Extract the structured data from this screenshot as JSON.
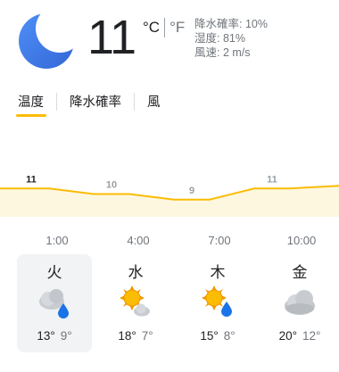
{
  "current": {
    "temperature": "11",
    "unit_c": "°C",
    "unit_f": "°F",
    "precipitation": "降水確率: 10%",
    "humidity": "湿度: 81%",
    "wind": "風速: 2 m/s",
    "icon": "moon-icon"
  },
  "tabs": [
    {
      "label": "温度",
      "active": true
    },
    {
      "label": "降水確率",
      "active": false
    },
    {
      "label": "風",
      "active": false
    }
  ],
  "chart_data": {
    "type": "area",
    "x": [
      "1:00",
      "4:00",
      "7:00",
      "10:00"
    ],
    "values": [
      11,
      10,
      9,
      11
    ],
    "labels": [
      "11",
      "10",
      "9",
      "11"
    ],
    "ylim": [
      8,
      12
    ],
    "colors": {
      "line": "#fbbc04",
      "fill": "#fef7e0"
    }
  },
  "days": [
    {
      "name": "火",
      "high": "13°",
      "low": "9°",
      "icon": "rain-cloud-icon",
      "selected": true
    },
    {
      "name": "水",
      "high": "18°",
      "low": "7°",
      "icon": "sun-cloud-icon",
      "selected": false
    },
    {
      "name": "木",
      "high": "15°",
      "low": "8°",
      "icon": "sun-rain-icon",
      "selected": false
    },
    {
      "name": "金",
      "high": "20°",
      "low": "12°",
      "icon": "cloud-icon",
      "selected": false
    }
  ]
}
